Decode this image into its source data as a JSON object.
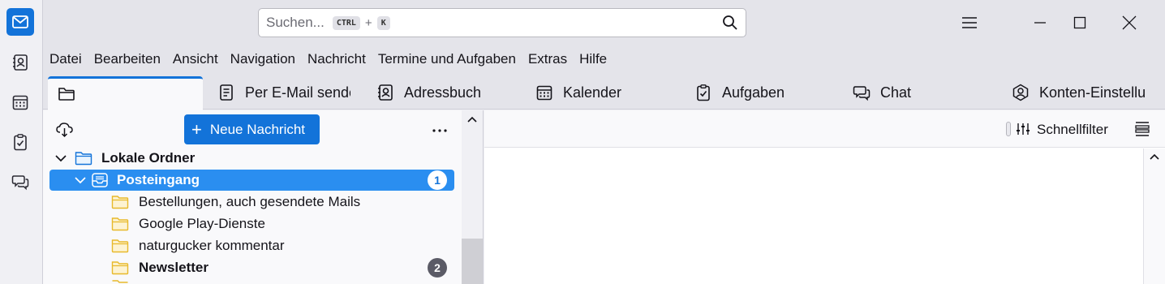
{
  "spaces": {
    "items": [
      {
        "name": "mail",
        "icon": "envelope-icon",
        "active": true
      },
      {
        "name": "addressbook",
        "icon": "contact-card-icon"
      },
      {
        "name": "calendar",
        "icon": "calendar-icon"
      },
      {
        "name": "tasks",
        "icon": "clipboard-check-icon"
      },
      {
        "name": "chat",
        "icon": "chat-bubbles-icon"
      }
    ]
  },
  "titlebar": {
    "search_placeholder": "Suchen...",
    "shortcut_key1": "CTRL",
    "shortcut_plus": "+",
    "shortcut_key2": "K"
  },
  "menubar": {
    "items": [
      "Datei",
      "Bearbeiten",
      "Ansicht",
      "Navigation",
      "Nachricht",
      "Termine und Aufgaben",
      "Extras",
      "Hilfe"
    ]
  },
  "tabs": [
    {
      "label": "Per E-Mail sende",
      "icon": "document-icon"
    },
    {
      "label": "Adressbuch",
      "icon": "contact-card-icon"
    },
    {
      "label": "Kalender",
      "icon": "calendar-icon"
    },
    {
      "label": "Aufgaben",
      "icon": "clipboard-check-icon"
    },
    {
      "label": "Chat",
      "icon": "chat-bubbles-icon"
    },
    {
      "label": "Konten-Einstellu",
      "icon": "account-icon"
    }
  ],
  "folderpane": {
    "new_message_label": "Neue Nachricht",
    "account": "Lokale Ordner",
    "inbox": {
      "label": "Posteingang",
      "unread": "1"
    },
    "folders": [
      {
        "label": "Bestellungen, auch gesendete Mails",
        "unread": ""
      },
      {
        "label": "Google Play-Dienste",
        "unread": ""
      },
      {
        "label": "naturgucker kommentar",
        "unread": ""
      },
      {
        "label": "Newsletter",
        "unread": "2"
      }
    ]
  },
  "quickfilter": {
    "label": "Schnellfilter"
  },
  "colors": {
    "accent": "#1373d9",
    "selected": "#2a8ef0",
    "folder": "#f2c94c"
  }
}
